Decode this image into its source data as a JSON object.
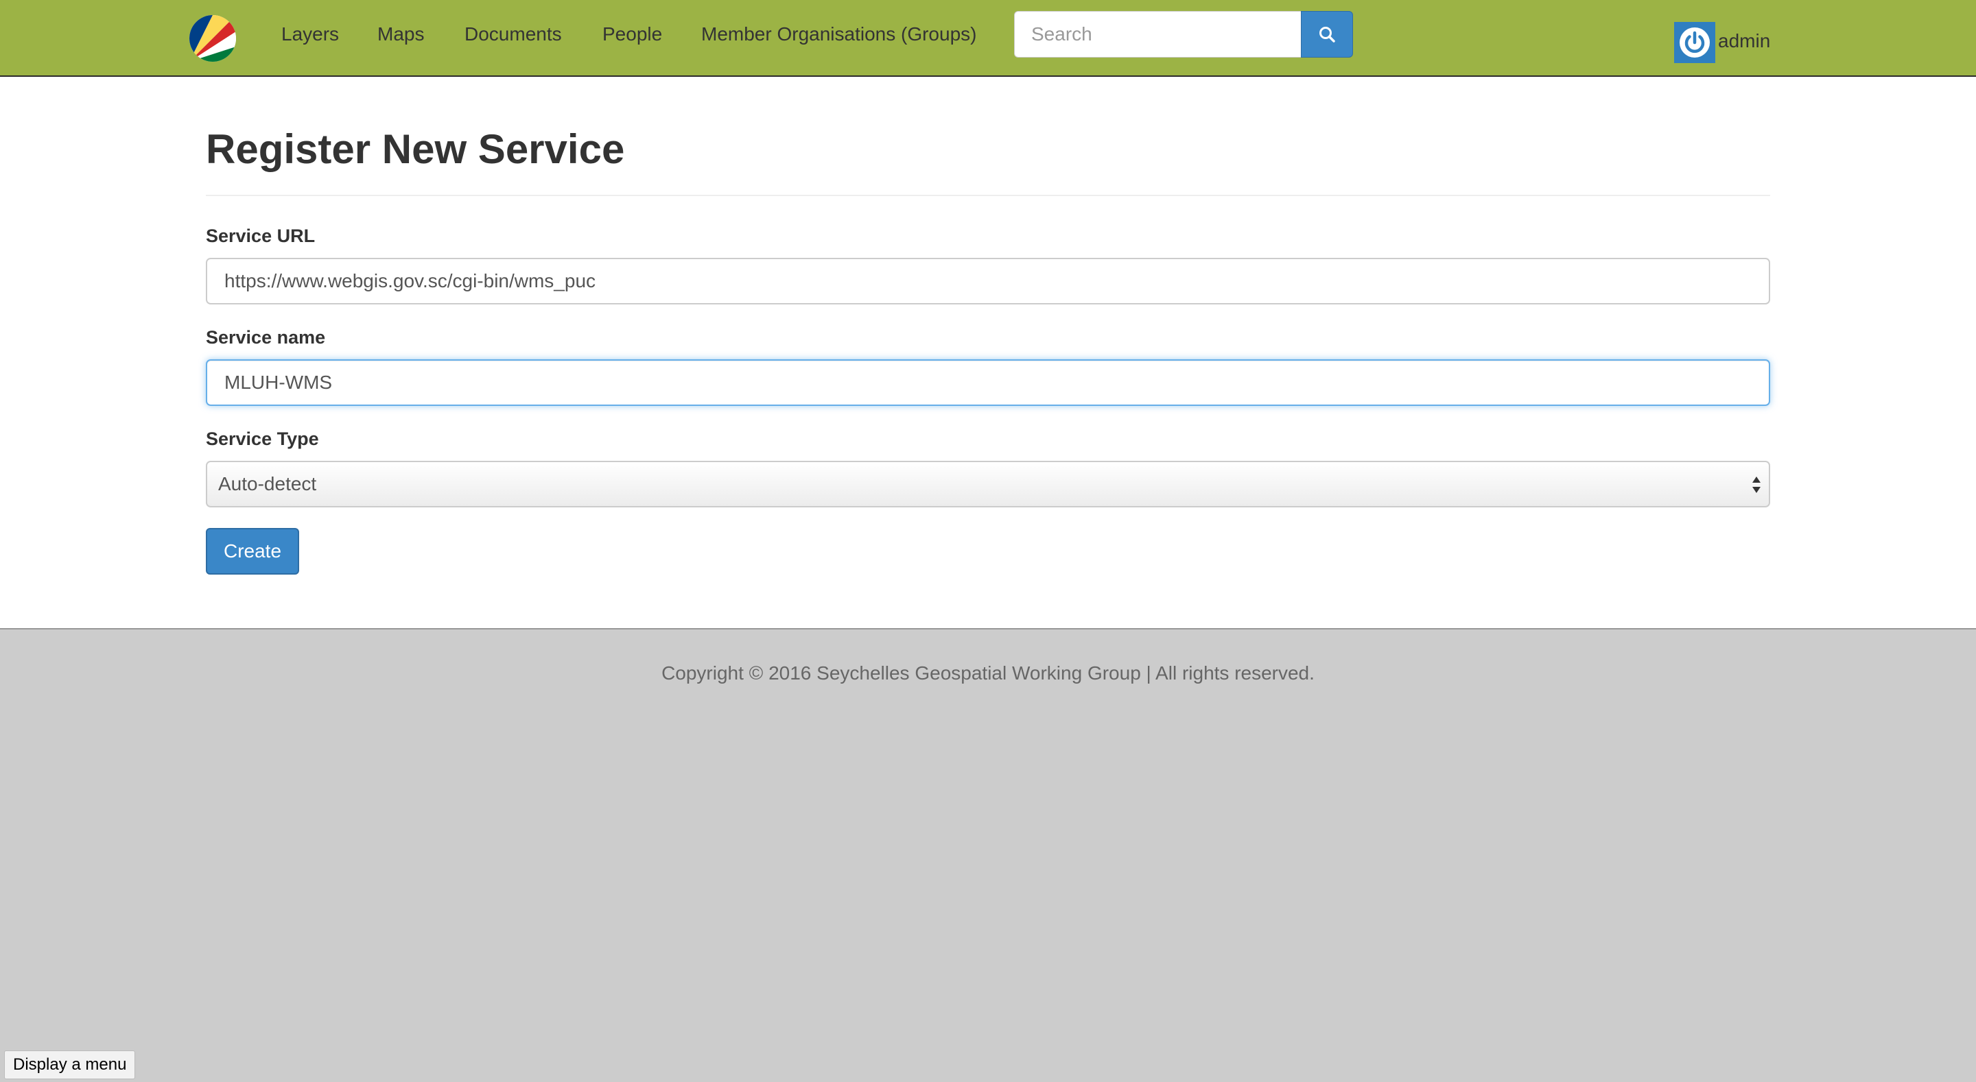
{
  "navbar": {
    "logo_icon": "seychelles-flag-logo-icon",
    "links": [
      "Layers",
      "Maps",
      "Documents",
      "People",
      "Member Organisations (Groups)"
    ],
    "search": {
      "placeholder": "Search",
      "button_icon": "search-icon"
    },
    "user": {
      "avatar_icon": "power-icon",
      "name": "admin"
    },
    "colors": {
      "bar": "#9cb345",
      "primary": "#3a87c8"
    }
  },
  "form": {
    "title": "Register New Service",
    "url": {
      "label": "Service URL",
      "value": "https://www.webgis.gov.sc/cgi-bin/wms_puc"
    },
    "name": {
      "label": "Service name",
      "value": "MLUH-WMS"
    },
    "type": {
      "label": "Service Type",
      "selected": "Auto-detect"
    },
    "submit_label": "Create"
  },
  "footer": {
    "copyright": "Copyright © 2016 Seychelles Geospatial Working Group | All rights reserved."
  },
  "overlay": {
    "menu_tip": "Display a menu"
  }
}
